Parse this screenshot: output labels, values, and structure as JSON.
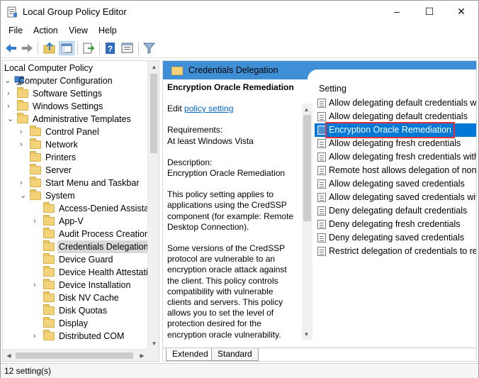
{
  "window": {
    "title": "Local Group Policy Editor",
    "controls": {
      "minimize": "–",
      "maximize": "☐",
      "close": "✕"
    }
  },
  "menubar": {
    "items": [
      "File",
      "Action",
      "View",
      "Help"
    ]
  },
  "toolbar": {
    "buttons": [
      "back-icon",
      "forward-icon",
      "up-folder-icon",
      "show-hide-tree-icon",
      "export-list-icon",
      "help-icon",
      "properties-icon",
      "filter-icon"
    ]
  },
  "tree": {
    "items": [
      {
        "label": "Local Computer Policy",
        "level": 0,
        "expander": "",
        "folder": false
      },
      {
        "label": "Computer Configuration",
        "level": 0,
        "expander": "expanded",
        "folder": false,
        "icon": "computer-icon"
      },
      {
        "label": "Software Settings",
        "level": 1,
        "expander": "collapsed",
        "folder": true
      },
      {
        "label": "Windows Settings",
        "level": 1,
        "expander": "collapsed",
        "folder": true
      },
      {
        "label": "Administrative Templates",
        "level": 1,
        "expander": "expanded",
        "folder": true
      },
      {
        "label": "Control Panel",
        "level": 2,
        "expander": "collapsed",
        "folder": true
      },
      {
        "label": "Network",
        "level": 2,
        "expander": "collapsed",
        "folder": true
      },
      {
        "label": "Printers",
        "level": 2,
        "expander": "",
        "folder": true
      },
      {
        "label": "Server",
        "level": 2,
        "expander": "",
        "folder": true
      },
      {
        "label": "Start Menu and Taskbar",
        "level": 2,
        "expander": "collapsed",
        "folder": true
      },
      {
        "label": "System",
        "level": 2,
        "expander": "expanded",
        "folder": true
      },
      {
        "label": "Access-Denied Assistan",
        "level": 3,
        "expander": "",
        "folder": true
      },
      {
        "label": "App-V",
        "level": 3,
        "expander": "collapsed",
        "folder": true
      },
      {
        "label": "Audit Process Creation",
        "level": 3,
        "expander": "",
        "folder": true
      },
      {
        "label": "Credentials Delegation",
        "level": 3,
        "expander": "",
        "folder": true,
        "selected": true
      },
      {
        "label": "Device Guard",
        "level": 3,
        "expander": "",
        "folder": true
      },
      {
        "label": "Device Health Attestati",
        "level": 3,
        "expander": "",
        "folder": true
      },
      {
        "label": "Device Installation",
        "level": 3,
        "expander": "collapsed",
        "folder": true
      },
      {
        "label": "Disk NV Cache",
        "level": 3,
        "expander": "",
        "folder": true
      },
      {
        "label": "Disk Quotas",
        "level": 3,
        "expander": "",
        "folder": true
      },
      {
        "label": "Display",
        "level": 3,
        "expander": "",
        "folder": true
      },
      {
        "label": "Distributed COM",
        "level": 3,
        "expander": "collapsed",
        "folder": true
      }
    ]
  },
  "right": {
    "header_title": "Credentials Delegation",
    "description": {
      "title": "Encryption Oracle Remediation",
      "edit_prefix": "Edit ",
      "edit_link": "policy setting ",
      "requirements_label": "Requirements:",
      "requirements_value": "At least Windows Vista",
      "description_label": "Description:",
      "description_value": "Encryption Oracle Remediation",
      "para1": "This policy setting applies to applications using the CredSSP component (for example: Remote Desktop Connection).",
      "para2": "Some versions of the CredSSP protocol are vulnerable to an encryption oracle attack against the client.  This policy controls compatibility with vulnerable clients and servers.  This policy allows you to set the level of protection desired for the encryption oracle vulnerability."
    },
    "settings_header": "Setting",
    "settings": [
      {
        "label": "Allow delegating default credentials wit",
        "selected": false
      },
      {
        "label": "Allow delegating default credentials",
        "selected": false
      },
      {
        "label": "Encryption Oracle Remediation",
        "selected": true
      },
      {
        "label": "Allow delegating fresh credentials",
        "selected": false
      },
      {
        "label": "Allow delegating fresh credentials with",
        "selected": false
      },
      {
        "label": "Remote host allows delegation of non-e",
        "selected": false
      },
      {
        "label": "Allow delegating saved credentials",
        "selected": false
      },
      {
        "label": "Allow delegating saved credentials with",
        "selected": false
      },
      {
        "label": "Deny delegating default credentials",
        "selected": false
      },
      {
        "label": "Deny delegating fresh credentials",
        "selected": false
      },
      {
        "label": "Deny delegating saved credentials",
        "selected": false
      },
      {
        "label": "Restrict delegation of credentials to rem",
        "selected": false
      }
    ],
    "tabs": [
      "Extended",
      "Standard"
    ]
  },
  "status": {
    "text": "12 setting(s)"
  },
  "colors": {
    "accent": "#0078d7",
    "header": "#3e8fd6",
    "highlight_outline": "#e0303a"
  }
}
